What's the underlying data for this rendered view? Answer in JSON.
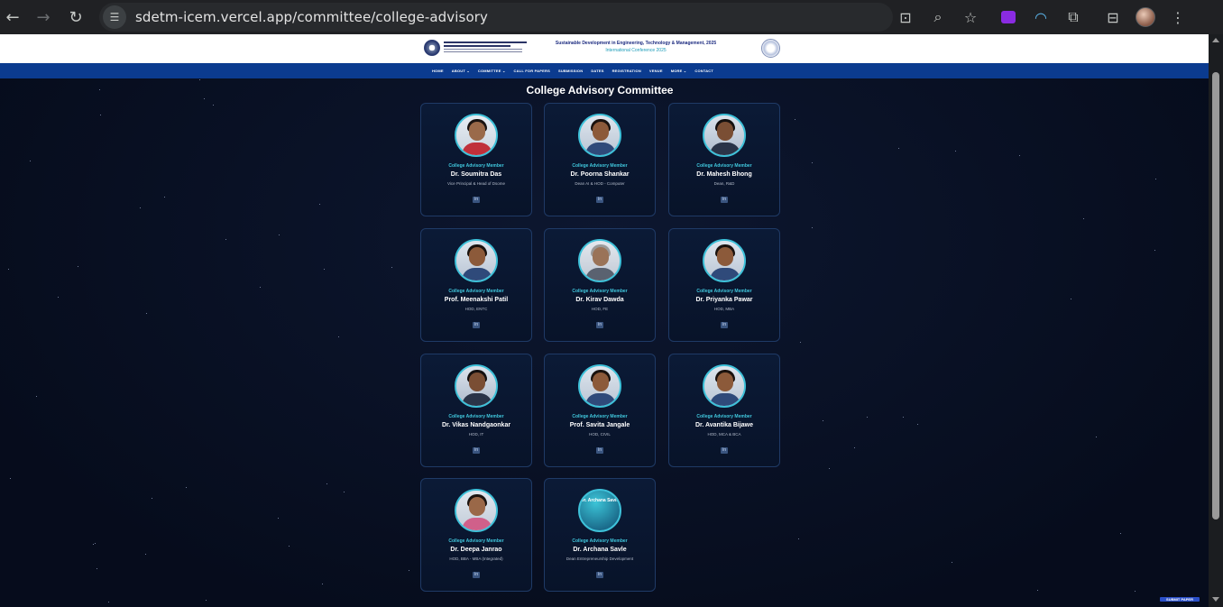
{
  "browser": {
    "url": "sdetm-icem.vercel.app/committee/college-advisory"
  },
  "header": {
    "conference_line1": "Sustainable Development in Engineering, Technology & Management, 2025",
    "conference_line2": "International Conference 2025"
  },
  "nav": {
    "items": [
      "HOME",
      "ABOUT ⌄",
      "COMMITTEE ⌄",
      "CALL FOR PAPERS",
      "SUBMISSION",
      "DATES",
      "REGISTRATION",
      "VENUE",
      "MORE ⌄",
      "CONTACT"
    ]
  },
  "page": {
    "title": "College Advisory Committee"
  },
  "members": [
    {
      "role": "College Advisory Member",
      "name": "Dr. Soumitra Das",
      "designation": "Vice Principal & Head of Dsome",
      "photo": "portrait-red"
    },
    {
      "role": "College Advisory Member",
      "name": "Dr. Poorna Shankar",
      "designation": "Dean AI & HOD - Computer",
      "photo": "portrait-f"
    },
    {
      "role": "College Advisory Member",
      "name": "Dr. Mahesh Bhong",
      "designation": "Dean, R&D",
      "photo": "portrait-m"
    },
    {
      "role": "College Advisory Member",
      "name": "Prof. Meenakshi Patil",
      "designation": "HOD, ENTC",
      "photo": "portrait-f"
    },
    {
      "role": "College Advisory Member",
      "name": "Dr. Kirav Dawda",
      "designation": "HOD, FE",
      "photo": "portrait-m-grey"
    },
    {
      "role": "College Advisory Member",
      "name": "Dr. Priyanka Pawar",
      "designation": "HOD, MBA",
      "photo": "portrait-f"
    },
    {
      "role": "College Advisory Member",
      "name": "Dr. Vikas Nandgaonkar",
      "designation": "HOD, IT",
      "photo": "portrait-m"
    },
    {
      "role": "College Advisory Member",
      "name": "Prof. Savita Jangale",
      "designation": "HOD, CIVIL",
      "photo": "portrait-f"
    },
    {
      "role": "College Advisory Member",
      "name": "Dr. Avantika Bijawe",
      "designation": "HOD, MCA & BCA",
      "photo": "portrait-f"
    },
    {
      "role": "College Advisory Member",
      "name": "Dr. Deepa Janrao",
      "designation": "HOD, BBA - MBA (Integrated)",
      "photo": "portrait-f-pink"
    },
    {
      "role": "College Advisory Member",
      "name": "Dr. Archana Savle",
      "designation": "Dean Entrepreneurship Development",
      "photo": "placeholder",
      "placeholder_text": "Dr. Archana Savle"
    }
  ],
  "linkedin_icon": "linkedin-icon",
  "badge": {
    "text": "SUBMIT PAPER"
  },
  "colors": {
    "nav_bg": "#0b3b8f",
    "accent_cyan": "#40c8de",
    "page_bg": "#0a1226"
  }
}
